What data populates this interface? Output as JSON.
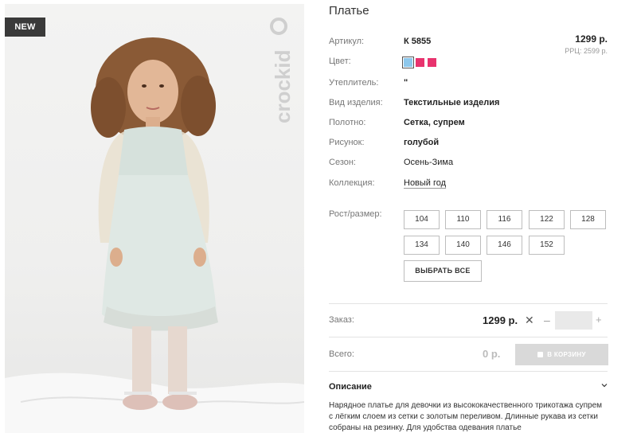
{
  "badge": "NEW",
  "brand_logo_text": "crockid",
  "product": {
    "title": "Платье",
    "price": "1299 р.",
    "rrp": "РРЦ: 2599 р."
  },
  "attributes": {
    "article_label": "Артикул:",
    "article_value": "К 5855",
    "color_label": "Цвет:",
    "colors": [
      "#8ec8ec",
      "#e8336e",
      "#e8336e"
    ],
    "insulation_label": "Утеплитель:",
    "insulation_value": "\"",
    "type_label": "Вид изделия:",
    "type_value": "Текстильные изделия",
    "fabric_label": "Полотно:",
    "fabric_value": "Сетка, супрем",
    "pattern_label": "Рисунок:",
    "pattern_value": "голубой",
    "season_label": "Сезон:",
    "season_value": "Осень-Зима",
    "collection_label": "Коллекция:",
    "collection_value": "Новый год"
  },
  "sizes": {
    "label": "Рост/размер:",
    "row1": [
      "104",
      "110",
      "116",
      "122",
      "128"
    ],
    "row2": [
      "134",
      "140",
      "146",
      "152"
    ],
    "select_all": "ВЫБРАТЬ ВСЕ"
  },
  "order": {
    "label": "Заказ:",
    "price": "1299 р.",
    "times": "✕",
    "minus": "–",
    "plus": "+",
    "quantity": ""
  },
  "total": {
    "label": "Всего:",
    "value": "0 р.",
    "cart_button": "В КОРЗИНУ"
  },
  "description": {
    "title": "Описание",
    "text": "Нарядное платье для девочки из высококачественного трикотажа супрем с лёгким слоем из сетки с золотым переливом. Длинные рукава из сетки собраны на резинку. Для удобства одевания платье"
  }
}
